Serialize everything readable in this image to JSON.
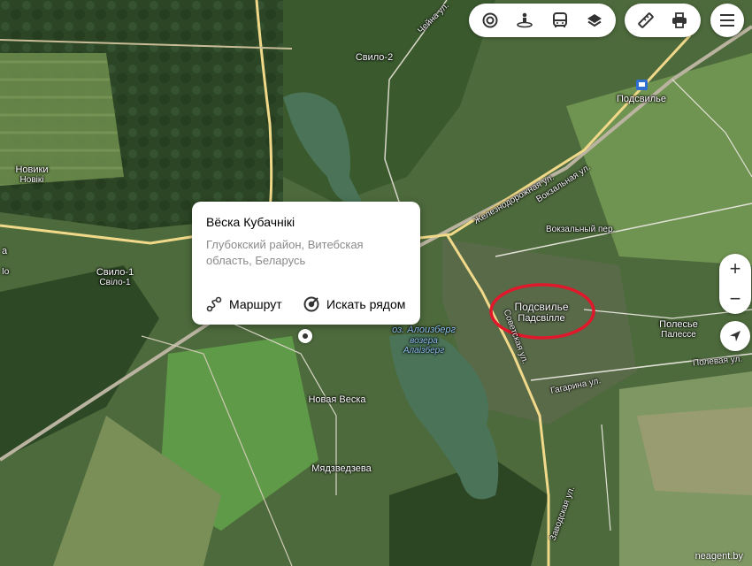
{
  "map": {
    "place_labels": {
      "svilo2": "Свило-2",
      "novikiRu": "Новики",
      "novikiBy": "Новікі",
      "svilo1Ru": "Свило-1",
      "svilo1By": "Свіло-1",
      "podsvilyeRu": "Подсвилье",
      "podsvilyeBy": "Падсвілле",
      "station": "Подсвилье",
      "polesyeRu": "Полесье",
      "polesyeBy": "Палессе",
      "novayaVeska": "Новая Веска",
      "myadzvedzeva": "Мядзведзева",
      "lakeRu": "оз. Алоизберг",
      "lakeBy1": "возера",
      "lakeBy2": "Алаізберг",
      "leftEdge": "а",
      "leftEdge2": "Iо"
    },
    "street_labels": {
      "vokzalnaya": "Вокзальная ул.",
      "vokzalnyPer": "Вокзальный пер.",
      "zheleznodorozhnaya": "Железнодорожная ул.",
      "polevaya": "Полевая ул.",
      "gagarina": "Гагарина ул.",
      "zavodskaya": "Заводская ул.",
      "sovetskaya": "Советская ул.",
      "teatr": "Чейна ул."
    },
    "colors": {
      "forest": "#2f4a26",
      "field": "#6f8f4f",
      "water": "#4a7357",
      "road": "#f1d98a",
      "highlight": "#e0182b"
    }
  },
  "toolbar": {
    "layers": [
      "traffic-icon",
      "panorama-icon",
      "transport-icon",
      "layers-icon"
    ],
    "tools": [
      "ruler-icon",
      "print-icon"
    ],
    "menu": "menu-icon"
  },
  "zoom": {
    "in": "+",
    "out": "−"
  },
  "popup": {
    "title": "Вёска Кубачнікі",
    "subtitle": "Глубокский район, Витебская область, Беларусь",
    "route_label": "Маршрут",
    "search_label": "Искать рядом"
  },
  "watermark": "neagent.by"
}
